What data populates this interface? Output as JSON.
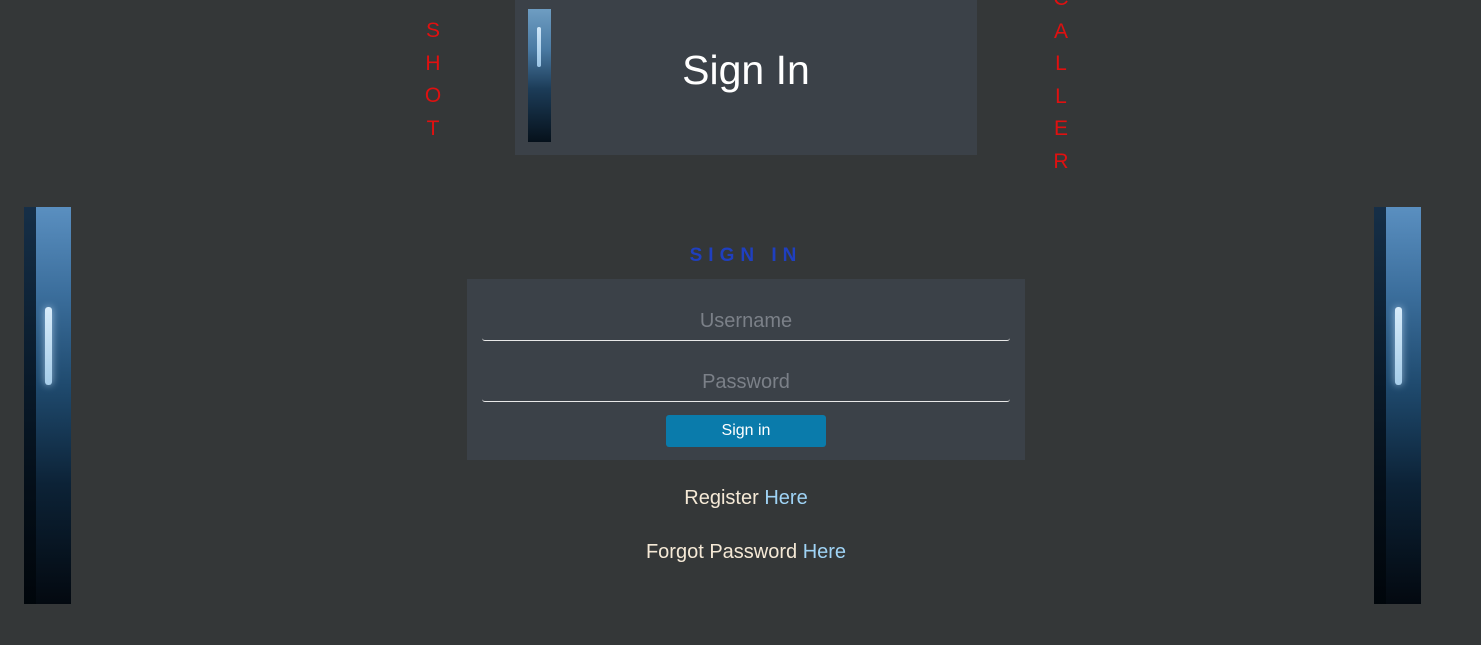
{
  "decor": {
    "left_word": [
      "S",
      "H",
      "O",
      "T"
    ],
    "right_word": [
      "C",
      "A",
      "L",
      "L",
      "E",
      "R"
    ]
  },
  "header": {
    "title": "Sign In"
  },
  "form": {
    "heading": "SIGN IN",
    "username_placeholder": "Username",
    "password_placeholder": "Password",
    "submit_label": "Sign in"
  },
  "links": {
    "register_text": "Register",
    "register_link": "Here",
    "forgot_text": "Forgot Password",
    "forgot_link": "Here"
  },
  "colors": {
    "background": "#343738",
    "panel": "#3b4148",
    "decor_text": "#e01010",
    "heading": "#1f3fbf",
    "button": "#0a7bab",
    "link": "#9fd3f5"
  }
}
